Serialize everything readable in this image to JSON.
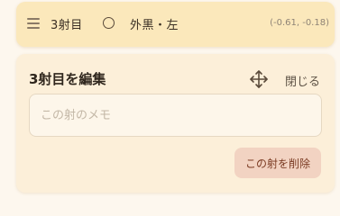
{
  "shot_row": {
    "shot_label": "3射目",
    "zone_label": "外黒・左",
    "coords": "(-0.61, -0.18)",
    "radio_selected": false,
    "icons": {
      "drag": "drag-handle-icon",
      "radio": "radio-circle-icon"
    }
  },
  "edit_card": {
    "title": "3射目を編集",
    "move_icon": "move-arrows-icon",
    "close_label": "閉じる",
    "memo_placeholder": "この射のメモ",
    "memo_value": "",
    "delete_label": "この射を削除"
  },
  "colors": {
    "background": "#fdf7ee",
    "shot_row_bg": "#fbe8bb",
    "card_bg": "#fcefd9",
    "delete_bg": "#f2d3c2",
    "delete_text": "#7a3a22"
  }
}
